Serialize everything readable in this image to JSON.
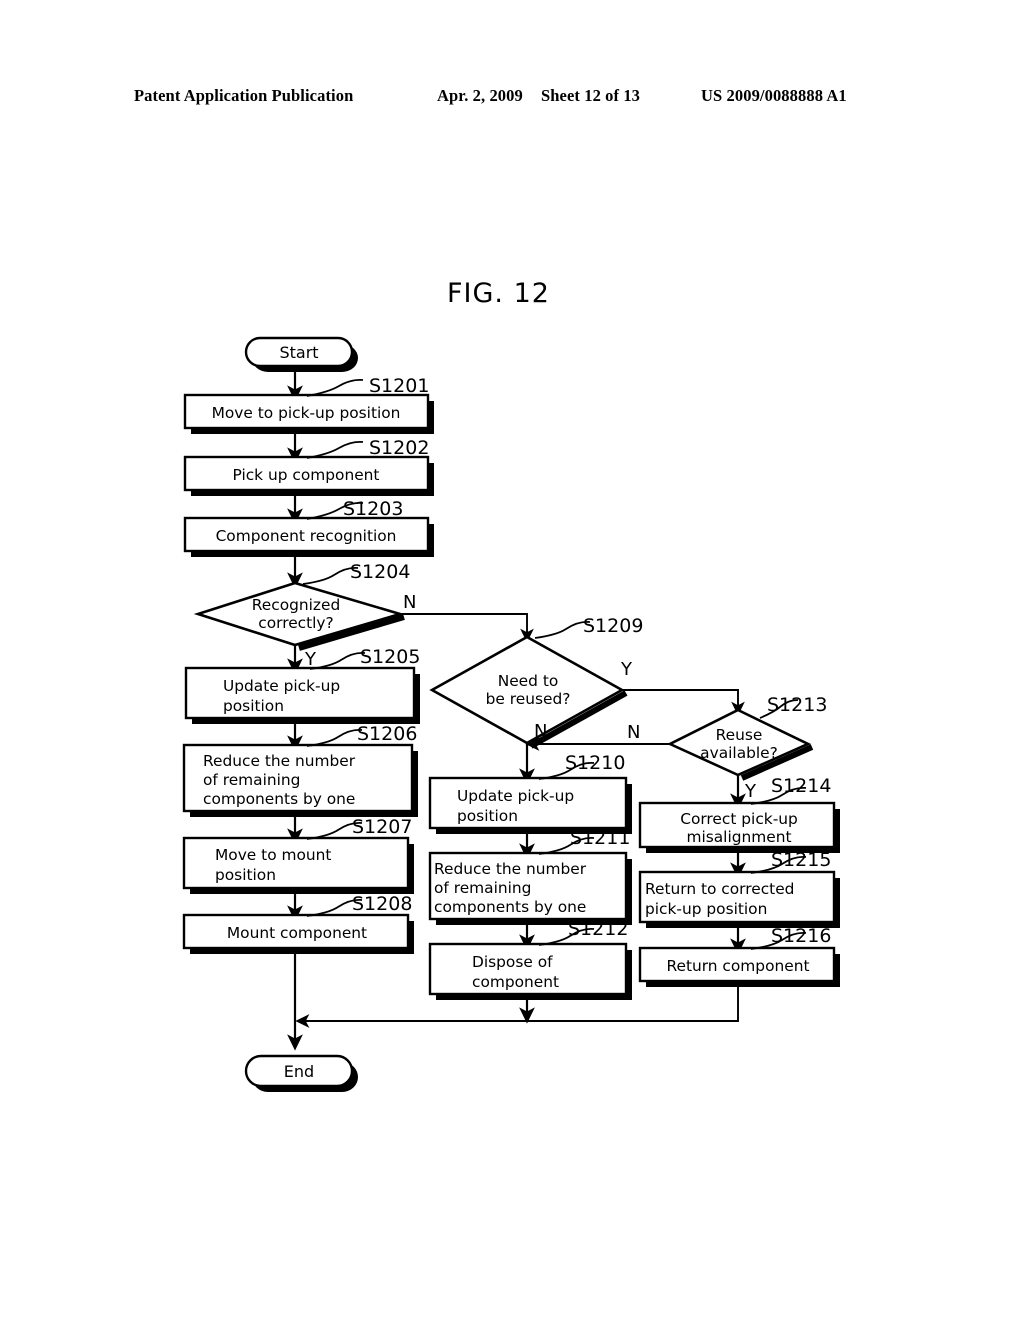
{
  "header": {
    "publication": "Patent Application Publication",
    "date": "Apr. 2, 2009",
    "sheet": "Sheet 12 of 13",
    "number": "US 2009/0088888 A1"
  },
  "figure": {
    "title": "FIG. 12"
  },
  "flowchart": {
    "terminators": {
      "start": "Start",
      "end": "End"
    },
    "branch_labels": {
      "s1204_no": "N",
      "s1204_yes": "Y",
      "s1209_yes": "Y",
      "s1209_no": "N",
      "s1213_no": "N",
      "s1213_yes": "Y"
    },
    "steps": [
      {
        "ref": "S1201",
        "text": "Move to pick-up position"
      },
      {
        "ref": "S1202",
        "text": "Pick up component"
      },
      {
        "ref": "S1203",
        "text": "Component recognition"
      },
      {
        "ref": "S1204",
        "text": "Recognized correctly?"
      },
      {
        "ref": "S1205",
        "text": "Update pick-up position"
      },
      {
        "ref": "S1206",
        "text": "Reduce the number of remaining components by one"
      },
      {
        "ref": "S1207",
        "text": "Move to mount position"
      },
      {
        "ref": "S1208",
        "text": "Mount component"
      },
      {
        "ref": "S1209",
        "text": "Need to be reused?"
      },
      {
        "ref": "S1210",
        "text": "Update pick-up position"
      },
      {
        "ref": "S1211",
        "text": "Reduce the number of remaining components by one"
      },
      {
        "ref": "S1212",
        "text": "Dispose of component"
      },
      {
        "ref": "S1213",
        "text": "Reuse available?"
      },
      {
        "ref": "S1214",
        "text": "Correct pick-up misalignment"
      },
      {
        "ref": "S1215",
        "text": "Return to corrected pick-up position"
      },
      {
        "ref": "S1216",
        "text": "Return component"
      }
    ],
    "lines": {
      "s1201_l1": "Move to pick-up position",
      "s1202_l1": "Pick up component",
      "s1203_l1": "Component recognition",
      "s1204_l1": "Recognized",
      "s1204_l2": "correctly?",
      "s1205_l1": "Update pick-up",
      "s1205_l2": "position",
      "s1206_l1": "Reduce the number",
      "s1206_l2": "of remaining",
      "s1206_l3": "components by one",
      "s1207_l1": "Move to mount",
      "s1207_l2": "position",
      "s1208_l1": "Mount component",
      "s1209_l1": "Need to",
      "s1209_l2": "be reused?",
      "s1210_l1": "Update pick-up",
      "s1210_l2": "position",
      "s1211_l1": "Reduce the number",
      "s1211_l2": "of remaining",
      "s1211_l3": "components by one",
      "s1212_l1": "Dispose of",
      "s1212_l2": "component",
      "s1213_l1": "Reuse",
      "s1213_l2": "available?",
      "s1214_l1": "Correct pick-up",
      "s1214_l2": "misalignment",
      "s1215_l1": "Return to corrected",
      "s1215_l2": "pick-up position",
      "s1216_l1": "Return component"
    },
    "refs": {
      "s1201": "S1201",
      "s1202": "S1202",
      "s1203": "S1203",
      "s1204": "S1204",
      "s1205": "S1205",
      "s1206": "S1206",
      "s1207": "S1207",
      "s1208": "S1208",
      "s1209": "S1209",
      "s1210": "S1210",
      "s1211": "S1211",
      "s1212": "S1212",
      "s1213": "S1213",
      "s1214": "S1214",
      "s1215": "S1215",
      "s1216": "S1216"
    }
  },
  "colors": {
    "ink": "#000000",
    "page": "#ffffff"
  }
}
